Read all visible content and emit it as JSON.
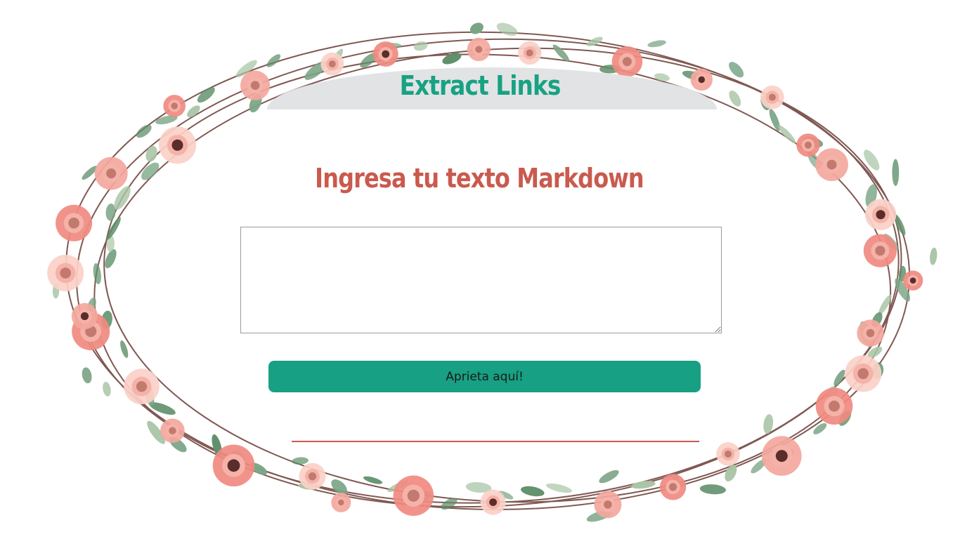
{
  "app": {
    "title": "Extract Links"
  },
  "main": {
    "heading": "Ingresa tu texto Markdown",
    "markdown_input": {
      "value": "",
      "placeholder": ""
    },
    "submit_label": "Aprieta aquí!"
  },
  "theme": {
    "title_color": "#17a283",
    "heading_color": "#ca5a4e",
    "button_color": "#17a083",
    "banner_color": "#e2e3e5",
    "divider_color": "#c85a50"
  },
  "decoration": {
    "background": "floral-wreath-image",
    "flower_colors": [
      "#f08a80",
      "#f3a79d",
      "#fbd0c8"
    ],
    "leaf_colors": [
      "#5f8f6a",
      "#7aa585",
      "#a9c5a6"
    ],
    "stem_color": "#6b3b34"
  }
}
